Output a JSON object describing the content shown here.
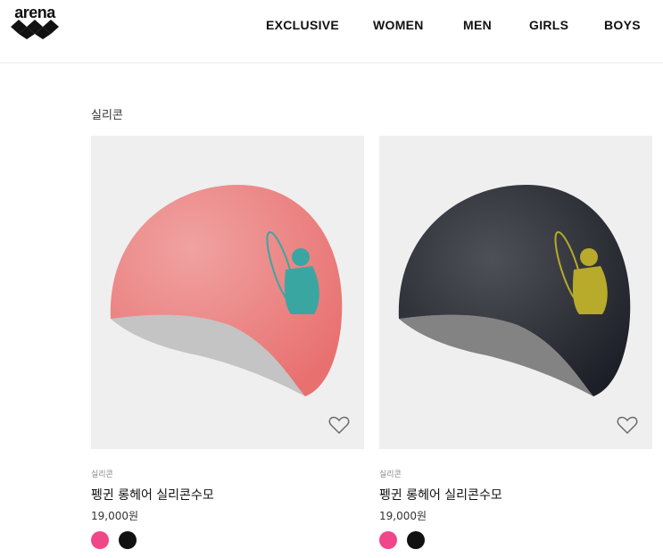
{
  "brand": {
    "logo_text": "arena"
  },
  "nav": {
    "items": [
      {
        "label": "EXCLUSIVE"
      },
      {
        "label": "WOMEN"
      },
      {
        "label": "MEN"
      },
      {
        "label": "GIRLS"
      },
      {
        "label": "BOYS"
      }
    ]
  },
  "category": {
    "title": "실리콘"
  },
  "products": [
    {
      "category": "실리콘",
      "name": "펭귄 롱헤어 실리콘수모",
      "price": "19,000원",
      "cap_color": "#e8706f",
      "logo_color": "#3aa6a2",
      "swatches": [
        "#f0468a",
        "#111111"
      ]
    },
    {
      "category": "실리콘",
      "name": "펭귄 롱헤어 실리콘수모",
      "price": "19,000원",
      "cap_color": "#1d1f28",
      "logo_color": "#b8aa2a",
      "swatches": [
        "#f0468a",
        "#111111"
      ]
    }
  ]
}
